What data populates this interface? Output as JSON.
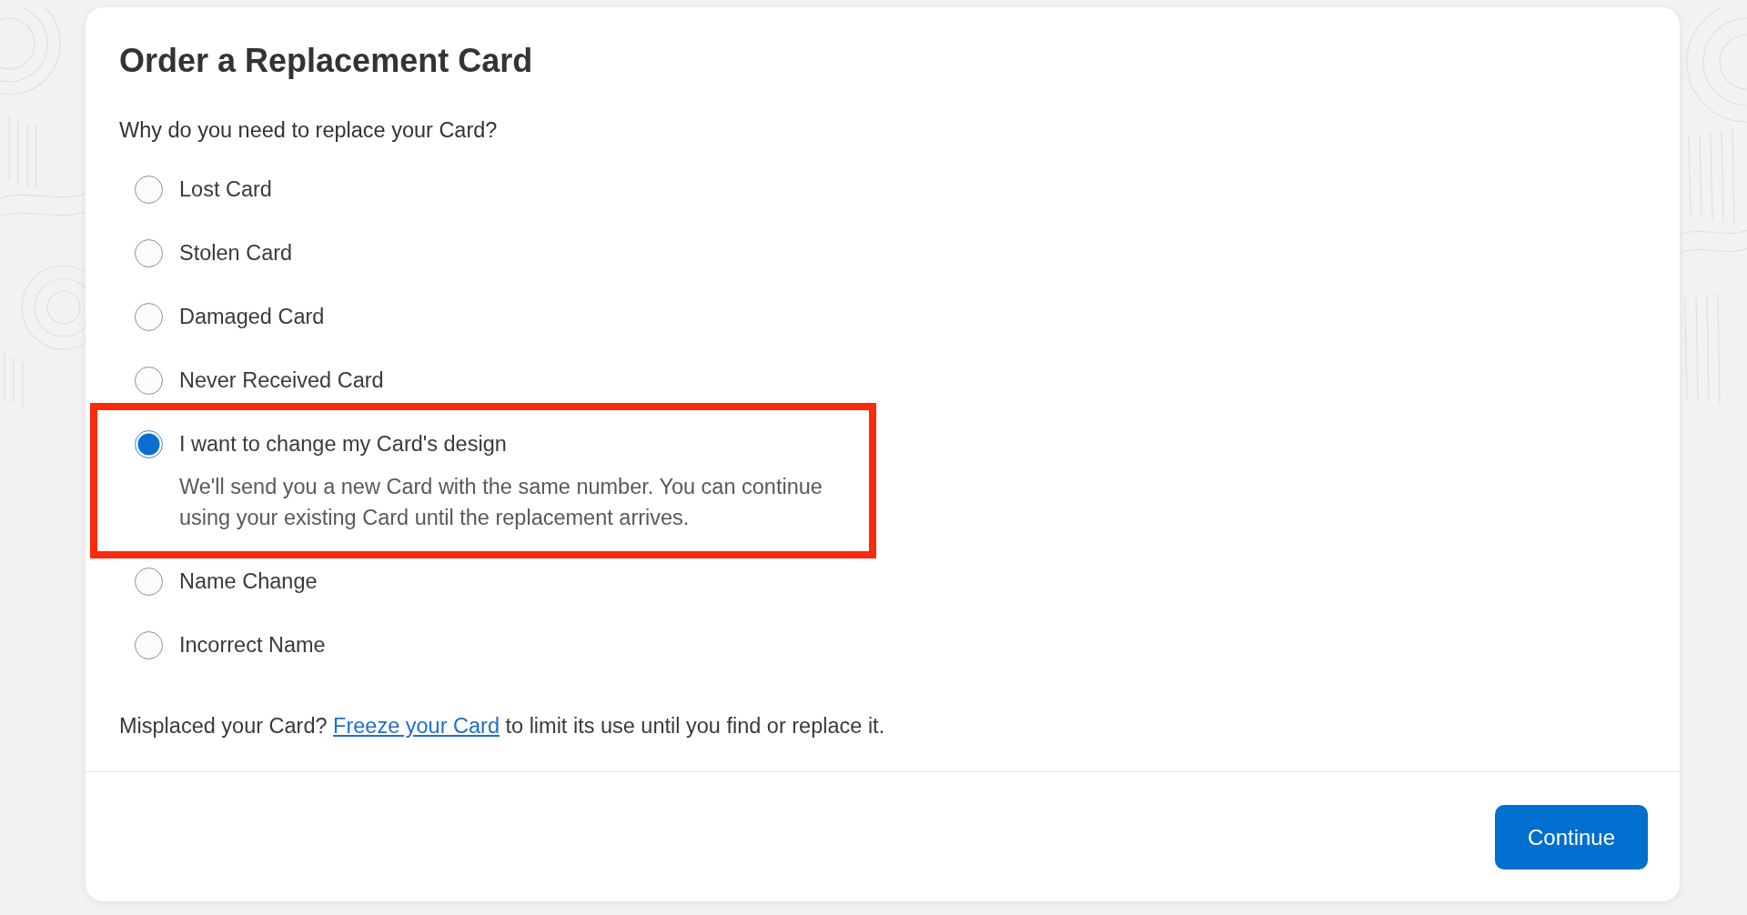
{
  "title": "Order a Replacement Card",
  "question": "Why do you need to replace your Card?",
  "options": [
    {
      "label": "Lost Card",
      "selected": false,
      "highlighted": false
    },
    {
      "label": "Stolen Card",
      "selected": false,
      "highlighted": false
    },
    {
      "label": "Damaged Card",
      "selected": false,
      "highlighted": false
    },
    {
      "label": "Never Received Card",
      "selected": false,
      "highlighted": false
    },
    {
      "label": "I want to change my Card's design",
      "selected": true,
      "highlighted": true,
      "description": "We'll send you a new Card with the same number. You can continue using your existing Card until the replacement arrives."
    },
    {
      "label": "Name Change",
      "selected": false,
      "highlighted": false
    },
    {
      "label": "Incorrect Name",
      "selected": false,
      "highlighted": false
    }
  ],
  "notice": {
    "lead": "Misplaced your Card?",
    "link": "Freeze your Card",
    "rest": "to limit its use until you find or replace it."
  },
  "buttons": [
    {
      "label": "Continue"
    }
  ]
}
